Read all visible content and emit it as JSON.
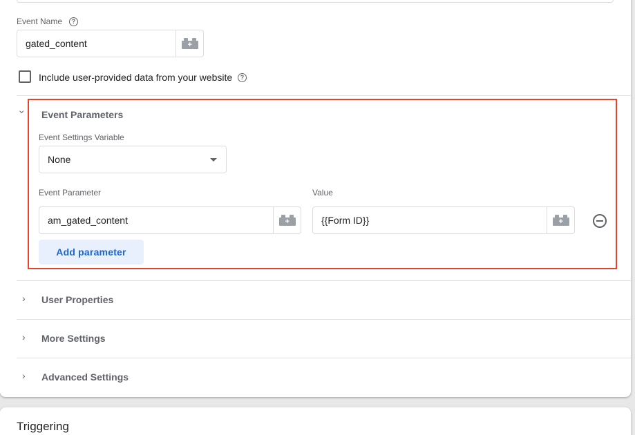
{
  "event_name": {
    "label": "Event Name",
    "help_icon": "help-icon",
    "value": "gated_content",
    "variable_icon": "variable-brick-icon"
  },
  "user_data_checkbox": {
    "label": "Include user-provided data from your website",
    "checked": false,
    "help_icon": "help-icon"
  },
  "event_parameters": {
    "title": "Event Parameters",
    "expanded": true,
    "highlight_color": "#e5432a",
    "settings_variable": {
      "label": "Event Settings Variable",
      "selected": "None"
    },
    "param_header": "Event Parameter",
    "value_header": "Value",
    "rows": [
      {
        "parameter": "am_gated_content",
        "value": "{{Form ID}}"
      }
    ],
    "add_button": "Add parameter"
  },
  "sections": {
    "user_properties": "User Properties",
    "more_settings": "More Settings",
    "advanced_settings": "Advanced Settings"
  },
  "triggering": {
    "title": "Triggering"
  },
  "colors": {
    "accent": "#1967d2",
    "accent_bg": "#e8f0fe"
  }
}
